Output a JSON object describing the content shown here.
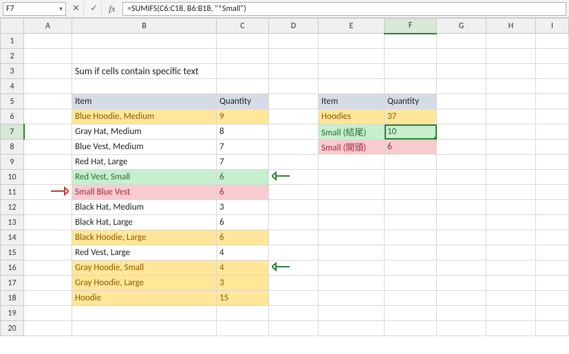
{
  "namebox": {
    "value": "F7"
  },
  "formula_bar": {
    "cancel_glyph": "✕",
    "enter_glyph": "✓",
    "fx_label": "fx",
    "formula": "=SUMIFS(C6:C18, B6:B18, \"*Small\")"
  },
  "columns": [
    "A",
    "B",
    "C",
    "D",
    "E",
    "F",
    "G",
    "H",
    "I"
  ],
  "row_count": 20,
  "selected": {
    "col": "F",
    "row": 7
  },
  "title_cell": "Sum if cells contain specific text",
  "headers_left": {
    "item": "Item",
    "qty": "Quantity"
  },
  "headers_right": {
    "item": "Item",
    "qty": "Quantity"
  },
  "left_rows": [
    {
      "item": "Blue Hoodie, Medium",
      "qty": 9,
      "fill": "yellow"
    },
    {
      "item": "Gray Hat, Medium",
      "qty": 8,
      "fill": ""
    },
    {
      "item": "Blue Vest, Medium",
      "qty": 7,
      "fill": ""
    },
    {
      "item": "Red Hat, Large",
      "qty": 7,
      "fill": ""
    },
    {
      "item": "Red Vest, Small",
      "qty": 6,
      "fill": "green",
      "arrow_right": true
    },
    {
      "item": "Small Blue Vest",
      "qty": 6,
      "fill": "pink",
      "arrow_left": true
    },
    {
      "item": "Black Hat, Medium",
      "qty": 3,
      "fill": ""
    },
    {
      "item": "Black Hat, Large",
      "qty": 6,
      "fill": ""
    },
    {
      "item": "Black Hoodie, Large",
      "qty": 6,
      "fill": "yellow"
    },
    {
      "item": "Red Vest, Large",
      "qty": 4,
      "fill": ""
    },
    {
      "item": "Gray Hoodie, Small",
      "qty": 4,
      "fill": "yellow",
      "arrow_right": true
    },
    {
      "item": "Gray Hoodie, Large",
      "qty": 3,
      "fill": "yellow"
    },
    {
      "item": "Hoodie",
      "qty": 15,
      "fill": "yellow"
    }
  ],
  "right_rows": [
    {
      "item": "Hoodies",
      "qty": 37,
      "fill": "yellow"
    },
    {
      "item": "Small (結尾)",
      "qty": 10,
      "fill": "green",
      "active": true
    },
    {
      "item": "Small (開頭)",
      "qty": 6,
      "fill": "pink"
    }
  ],
  "chart_data": {
    "type": "table",
    "title": "Sum if cells contain specific text",
    "left_table": {
      "columns": [
        "Item",
        "Quantity"
      ],
      "rows": [
        [
          "Blue Hoodie, Medium",
          9
        ],
        [
          "Gray Hat, Medium",
          8
        ],
        [
          "Blue Vest, Medium",
          7
        ],
        [
          "Red Hat, Large",
          7
        ],
        [
          "Red Vest, Small",
          6
        ],
        [
          "Small Blue Vest",
          6
        ],
        [
          "Black Hat, Medium",
          3
        ],
        [
          "Black Hat, Large",
          6
        ],
        [
          "Black Hoodie, Large",
          6
        ],
        [
          "Red Vest, Large",
          4
        ],
        [
          "Gray Hoodie, Small",
          4
        ],
        [
          "Gray Hoodie, Large",
          3
        ],
        [
          "Hoodie",
          15
        ]
      ]
    },
    "right_table": {
      "columns": [
        "Item",
        "Quantity"
      ],
      "rows": [
        [
          "Hoodies",
          37
        ],
        [
          "Small (結尾)",
          10
        ],
        [
          "Small (開頭)",
          6
        ]
      ]
    },
    "formula": "=SUMIFS(C6:C18, B6:B18, \"*Small\")"
  }
}
